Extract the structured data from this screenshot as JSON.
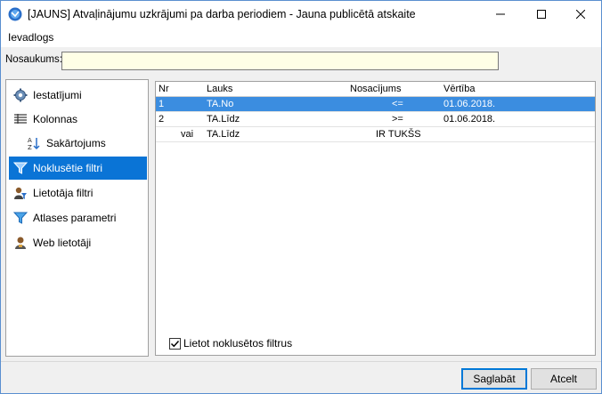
{
  "window": {
    "title": "[JAUNS] Atvaļinājumu uzkrājumi pa darba periodiem - Jauna publicētā atskaite",
    "menu_label": "Ievadlogs"
  },
  "name_field": {
    "label": "Nosaukums:",
    "value": ""
  },
  "sidebar": {
    "items": [
      {
        "label": "Iestatījumi",
        "icon": "gear-icon"
      },
      {
        "label": "Kolonnas",
        "icon": "columns-icon"
      },
      {
        "label": "Sakārtojums",
        "icon": "sort-icon"
      },
      {
        "label": "Noklusētie filtri",
        "icon": "filter-icon"
      },
      {
        "label": "Lietotāja filtri",
        "icon": "user-filter-icon"
      },
      {
        "label": "Atlases parametri",
        "icon": "funnel-icon"
      },
      {
        "label": "Web lietotāji",
        "icon": "web-user-icon"
      }
    ]
  },
  "grid": {
    "columns": {
      "nr": "Nr",
      "lauks": "Lauks",
      "nosacijums": "Nosacījums",
      "vertiba": "Vērtība"
    },
    "rows": [
      {
        "nr": "1",
        "op": "",
        "lauks": "TA.No",
        "nosacijums": "<=",
        "vertiba": "01.06.2018."
      },
      {
        "nr": "2",
        "op": "",
        "lauks": "TA.Līdz",
        "nosacijums": ">=",
        "vertiba": "01.06.2018."
      },
      {
        "nr": "",
        "op": "vai",
        "lauks": "TA.Līdz",
        "nosacijums": "IR TUKŠS",
        "vertiba": ""
      }
    ]
  },
  "checkbox": {
    "label": "Lietot noklusētos filtrus",
    "checked": true
  },
  "buttons": {
    "save": "Saglabāt",
    "cancel": "Atcelt"
  },
  "colors": {
    "selection": "#0a74d6",
    "row_selection": "#3b8de0",
    "input_bg": "#ffffe6"
  }
}
